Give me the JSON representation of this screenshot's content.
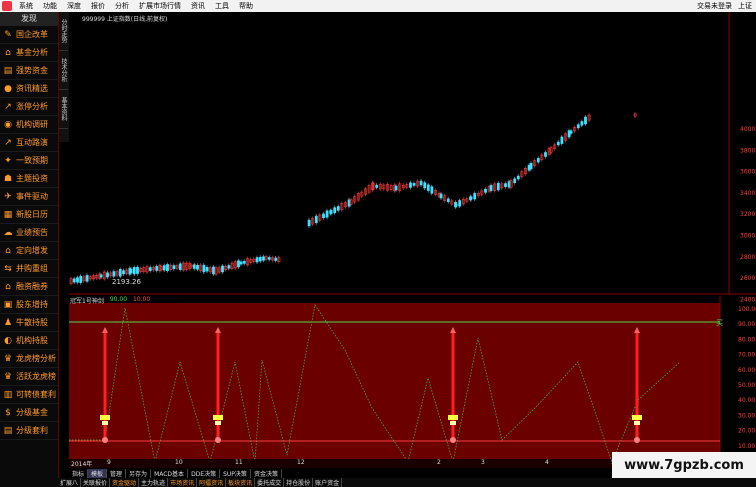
{
  "menu": {
    "items": [
      "系统",
      "功能",
      "深度",
      "报价",
      "分析",
      "扩展市场行情",
      "资讯",
      "工具",
      "帮助"
    ],
    "right": [
      "交易未登录",
      "上证"
    ]
  },
  "sidebar": {
    "title": "发现",
    "items": [
      {
        "label": "国企改革",
        "icon": "✎"
      },
      {
        "label": "基金分析",
        "icon": "⌂"
      },
      {
        "label": "强势资金",
        "icon": "▤"
      },
      {
        "label": "资讯精选",
        "icon": "●"
      },
      {
        "label": "涨停分析",
        "icon": "↗"
      },
      {
        "label": "机构调研",
        "icon": "◉"
      },
      {
        "label": "互动路演",
        "icon": "↗"
      },
      {
        "label": "一致预期",
        "icon": "✦"
      },
      {
        "label": "主题投资",
        "icon": "☗"
      },
      {
        "label": "事件驱动",
        "icon": "✈"
      },
      {
        "label": "新股日历",
        "icon": "▦"
      },
      {
        "label": "业绩预告",
        "icon": "☁"
      },
      {
        "label": "定向增发",
        "icon": "⌂"
      },
      {
        "label": "并购重组",
        "icon": "⇆"
      },
      {
        "label": "融资融券",
        "icon": "⌂"
      },
      {
        "label": "股东增持",
        "icon": "▣"
      },
      {
        "label": "牛散持股",
        "icon": "♟"
      },
      {
        "label": "机构持股",
        "icon": "◐"
      },
      {
        "label": "龙虎榜分析",
        "icon": "♛"
      },
      {
        "label": "活跃龙虎榜",
        "icon": "♛"
      },
      {
        "label": "可转债套利",
        "icon": "▥"
      },
      {
        "label": "分级基金",
        "icon": "$"
      },
      {
        "label": "分级套利",
        "icon": "▤"
      }
    ]
  },
  "vtabs": [
    "分时走势",
    "技术分析",
    "基本资料"
  ],
  "price_title": "999999 上证指数(日线,前复权)",
  "price_low_label": "2193.26",
  "price_axis": [
    "4000",
    "3800",
    "3600",
    "3400",
    "3200",
    "3000",
    "2800",
    "2600",
    "2400"
  ],
  "indicator": {
    "name": "冠军1号神剑",
    "value1": "90.00",
    "value2": "10.00",
    "axis": [
      "100.00",
      "90.00",
      "80.00",
      "70.00",
      "60.00",
      "50.00",
      "40.00",
      "30.00",
      "20.00",
      "10.00"
    ],
    "buy_label": "买"
  },
  "dates": [
    "2014年",
    "9",
    "10",
    "11",
    "12",
    "2",
    "3",
    "4",
    "5"
  ],
  "tabs1": [
    "指标",
    "模板",
    "管理",
    "另存为",
    "MACD基本",
    "DDE决策",
    "SUP决策",
    "资金决策"
  ],
  "tabs2": [
    "扩展八",
    "关联报价",
    "资金驱动",
    "主力轨迹",
    "市场资讯",
    "阿擂资讯",
    "板块资讯",
    "委托成交",
    "持仓股份",
    "账户资金"
  ],
  "watermark": "www.7gpzb.com",
  "colors": {
    "up": "#ff3c3c",
    "down": "#40e0ff",
    "indicator_bg": "#6b0000",
    "green_line": "#4cd94c"
  }
}
